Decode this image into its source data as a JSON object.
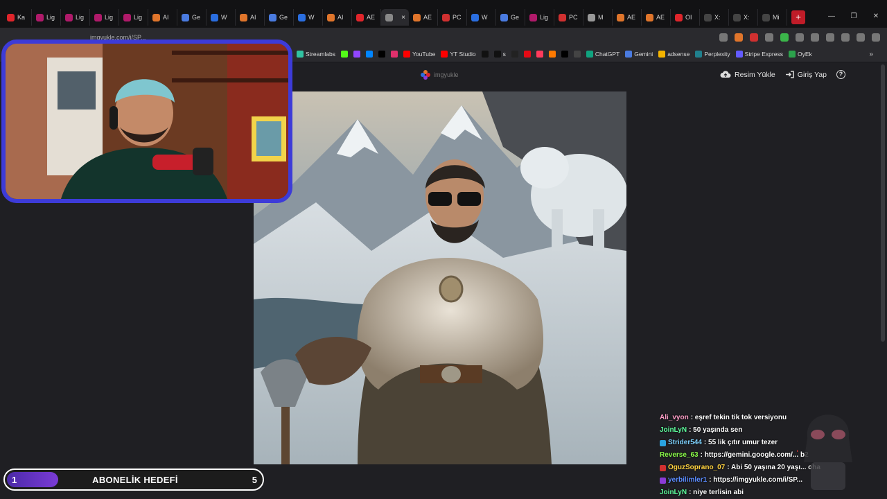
{
  "tabs": [
    {
      "label": "Ka",
      "color": "#e0252b"
    },
    {
      "label": "Lig",
      "color": "#b01a6a"
    },
    {
      "label": "Lig",
      "color": "#b01a6a"
    },
    {
      "label": "Lig",
      "color": "#b01a6a"
    },
    {
      "label": "Lig",
      "color": "#b01a6a"
    },
    {
      "label": "AI",
      "color": "#e0752b"
    },
    {
      "label": "Ge",
      "color": "#4a7be0"
    },
    {
      "label": "W",
      "color": "#2a6ee0"
    },
    {
      "label": "AI",
      "color": "#e0752b"
    },
    {
      "label": "Ge",
      "color": "#4a7be0"
    },
    {
      "label": "W",
      "color": "#2a6ee0"
    },
    {
      "label": "AI",
      "color": "#e0752b"
    },
    {
      "label": "AE",
      "color": "#e0252b"
    },
    {
      "label": "",
      "color": "#888888"
    },
    {
      "label": "AE",
      "color": "#e0752b"
    },
    {
      "label": "PC",
      "color": "#d03030"
    },
    {
      "label": "W",
      "color": "#2a6ee0"
    },
    {
      "label": "Ge",
      "color": "#4a7be0"
    },
    {
      "label": "Lig",
      "color": "#b01a6a"
    },
    {
      "label": "PC",
      "color": "#d03030"
    },
    {
      "label": "M",
      "color": "#999999"
    },
    {
      "label": "AE",
      "color": "#e0752b"
    },
    {
      "label": "AE",
      "color": "#e0752b"
    },
    {
      "label": "OI",
      "color": "#e0252b"
    },
    {
      "label": "X:",
      "color": "#444444"
    },
    {
      "label": "X:",
      "color": "#444444"
    },
    {
      "label": "Mi",
      "color": "#444444"
    }
  ],
  "active_tab_close": "×",
  "new_tab": "+",
  "window_controls": [
    "—",
    "❐",
    "✕"
  ],
  "address": {
    "url": "imgyukle.com/i/SP..."
  },
  "bookmarks": [
    {
      "label": "Streamlabs",
      "color": "#31c3a2"
    },
    {
      "label": "",
      "color": "#53fc18"
    },
    {
      "label": "",
      "color": "#9146ff"
    },
    {
      "label": "",
      "color": "#0085ff"
    },
    {
      "label": "",
      "color": "#000000"
    },
    {
      "label": "",
      "color": "#e1306c"
    },
    {
      "label": "YouTube",
      "color": "#ff0000"
    },
    {
      "label": "YT Studio",
      "color": "#ff0000"
    },
    {
      "label": "",
      "color": "#111111"
    },
    {
      "label": "s",
      "color": "#111111"
    },
    {
      "label": "",
      "color": "#222222"
    },
    {
      "label": "",
      "color": "#e50914"
    },
    {
      "label": "",
      "color": "#ff3b5c"
    },
    {
      "label": "",
      "color": "#ff7a00"
    },
    {
      "label": "",
      "color": "#000000"
    },
    {
      "label": "",
      "color": "#444444"
    },
    {
      "label": "ChatGPT",
      "color": "#10a37f"
    },
    {
      "label": "Gemini",
      "color": "#4a7be0"
    },
    {
      "label": "adsense",
      "color": "#f4b400"
    },
    {
      "label": "Perplexity",
      "color": "#20808d"
    },
    {
      "label": "Stripe Express",
      "color": "#635bff"
    },
    {
      "label": "OyEk",
      "color": "#2ca24c"
    }
  ],
  "bookmarks_more": "»",
  "site": {
    "logo_text": "imgyukle",
    "upload_label": "Resim Yükle",
    "login_label": "Giriş Yap",
    "help_label": "?"
  },
  "goal": {
    "start": "1",
    "title": "ABONELİK HEDEFİ",
    "end": "5",
    "progress": 0.2
  },
  "chat": [
    {
      "user": "Ali_vyon",
      "color": "#ff9ec7",
      "text": " : eşref tekin tik tok versiyonu",
      "badge": ""
    },
    {
      "user": "JoinLyN",
      "color": "#5eff9e",
      "text": " : 50 yaşında sen",
      "badge": ""
    },
    {
      "user": "Strider544",
      "color": "#7fd3ff",
      "text": " : 55 lik çıtır umur tezer",
      "badge": "#2aa3e0"
    },
    {
      "user": "Reverse_63",
      "color": "#8cff4a",
      "text": " : https://gemini.google.com/... b2",
      "badge": ""
    },
    {
      "user": "OguzSoprano_07",
      "color": "#ffd23f",
      "text": " : Abi 50 yaşına 20 yaşı... oha",
      "badge": "#d03030"
    },
    {
      "user": "yerbilimler1",
      "color": "#5b8cff",
      "text": " : https://imgyukle.com/i/SP...",
      "badge": "#8a3bd6"
    },
    {
      "user": "JoinLyN",
      "color": "#5eff9e",
      "text": " : niye terlisin abi",
      "badge": ""
    }
  ]
}
